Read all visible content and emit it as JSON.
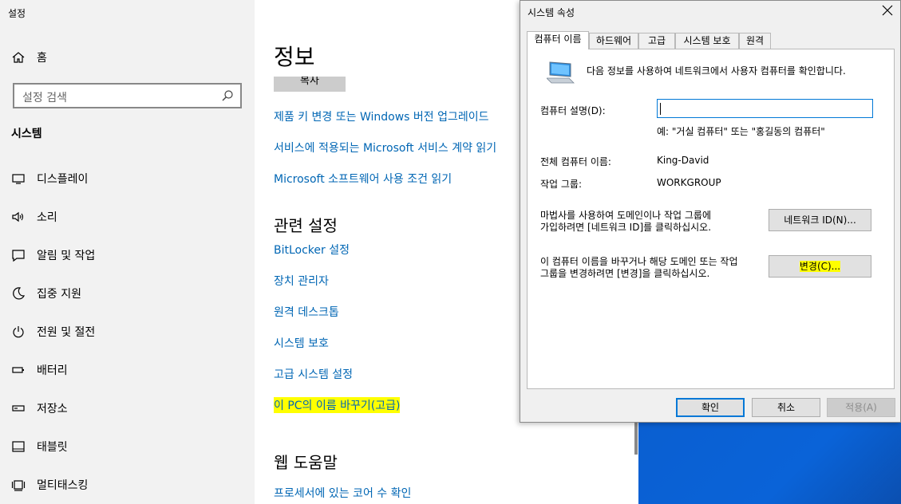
{
  "sidebar": {
    "app_title": "설정",
    "home_label": "홈",
    "search_placeholder": "설정 검색",
    "section_label": "시스템",
    "items": [
      {
        "label": "디스플레이",
        "icon": "display-icon"
      },
      {
        "label": "소리",
        "icon": "speaker-icon"
      },
      {
        "label": "알림 및 작업",
        "icon": "notification-icon"
      },
      {
        "label": "집중 지원",
        "icon": "moon-icon"
      },
      {
        "label": "전원 및 절전",
        "icon": "power-icon"
      },
      {
        "label": "배터리",
        "icon": "battery-icon"
      },
      {
        "label": "저장소",
        "icon": "storage-icon"
      },
      {
        "label": "태블릿",
        "icon": "tablet-icon"
      },
      {
        "label": "멀티태스킹",
        "icon": "multitasking-icon"
      }
    ]
  },
  "main": {
    "title": "정보",
    "copy_button": "복사",
    "links": [
      "제품 키 변경 또는 Windows 버전 업그레이드",
      "서비스에 적용되는 Microsoft 서비스 계약 읽기",
      "Microsoft 소프트웨어 사용 조건 읽기"
    ],
    "related_heading": "관련 설정",
    "related_links": [
      "BitLocker 설정",
      "장치 관리자",
      "원격 데스크톱",
      "시스템 보호",
      "고급 시스템 설정",
      "이 PC의 이름 바꾸기(고급)"
    ],
    "web_help_heading": "웹 도움말",
    "web_help_links": [
      "프로세서에 있는 코어 수 확인"
    ],
    "link_color": "#0066b4",
    "highlight_color": "#ffff00"
  },
  "dialog": {
    "title": "시스템 속성",
    "tabs": [
      "컴퓨터 이름",
      "하드웨어",
      "고급",
      "시스템 보호",
      "원격"
    ],
    "active_tab": "컴퓨터 이름",
    "intro": "다음 정보를 사용하여 네트워크에서 사용자 컴퓨터를 확인합니다.",
    "description_label": "컴퓨터 설명(D):",
    "description_value": "",
    "description_example": "예: \"거실 컴퓨터\" 또는 \"홍길동의 컴퓨터\"",
    "full_name_label": "전체 컴퓨터 이름:",
    "full_name_value": "King-David",
    "workgroup_label": "작업 그룹:",
    "workgroup_value": "WORKGROUP",
    "wizard_text_1": "마법사를 사용하여 도메인이나 작업 그룹에",
    "wizard_text_2": "가입하려면 [네트워크 ID]를 클릭하십시오.",
    "network_id_button": "네트워크 ID(N)...",
    "rename_text_1": "이 컴퓨터 이름을 바꾸거나 해당 도메인 또는 작업",
    "rename_text_2": "그룹을 변경하려면 [변경]을 클릭하십시오.",
    "change_button": "변경(C)...",
    "ok_button": "확인",
    "cancel_button": "취소",
    "apply_button": "적용(A)"
  }
}
